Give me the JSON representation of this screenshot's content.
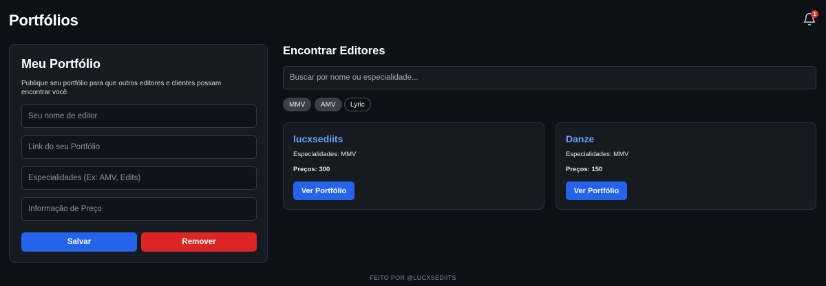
{
  "header": {
    "title": "Portfólios",
    "notifications_count": "1"
  },
  "my_portfolio": {
    "title": "Meu Portfólio",
    "description": "Publique seu portfólio para que outros editores e clientes possam encontrar você.",
    "fields": {
      "name_placeholder": "Seu nome de editor",
      "link_placeholder": "Link do seu Portfólio",
      "specialties_placeholder": "Especialidades (Ex: AMV, Edits)",
      "price_placeholder": "Informação de Preço"
    },
    "save_label": "Salvar",
    "remove_label": "Remover",
    "colors": {
      "save": "#2563eb",
      "remove": "#dc2626"
    }
  },
  "find_editors": {
    "title": "Encontrar Editores",
    "search_placeholder": "Buscar por nome ou especialidade...",
    "filters": [
      {
        "label": "MMV",
        "active": true
      },
      {
        "label": "AMV",
        "active": true
      },
      {
        "label": "Lyric",
        "active": false
      }
    ],
    "editors": [
      {
        "name": "lucxsediits",
        "specialties": "Especialidades: MMV",
        "price": "Preços: 300",
        "button": "Ver Portfólio"
      },
      {
        "name": "Danze",
        "specialties": "Especialidades: MMV",
        "price": "Preços: 150",
        "button": "Ver Portfólio"
      }
    ]
  },
  "footer": {
    "text": "FEITO POR @LUCXSEDIITS"
  },
  "icons": {
    "bell": "bell-icon"
  }
}
